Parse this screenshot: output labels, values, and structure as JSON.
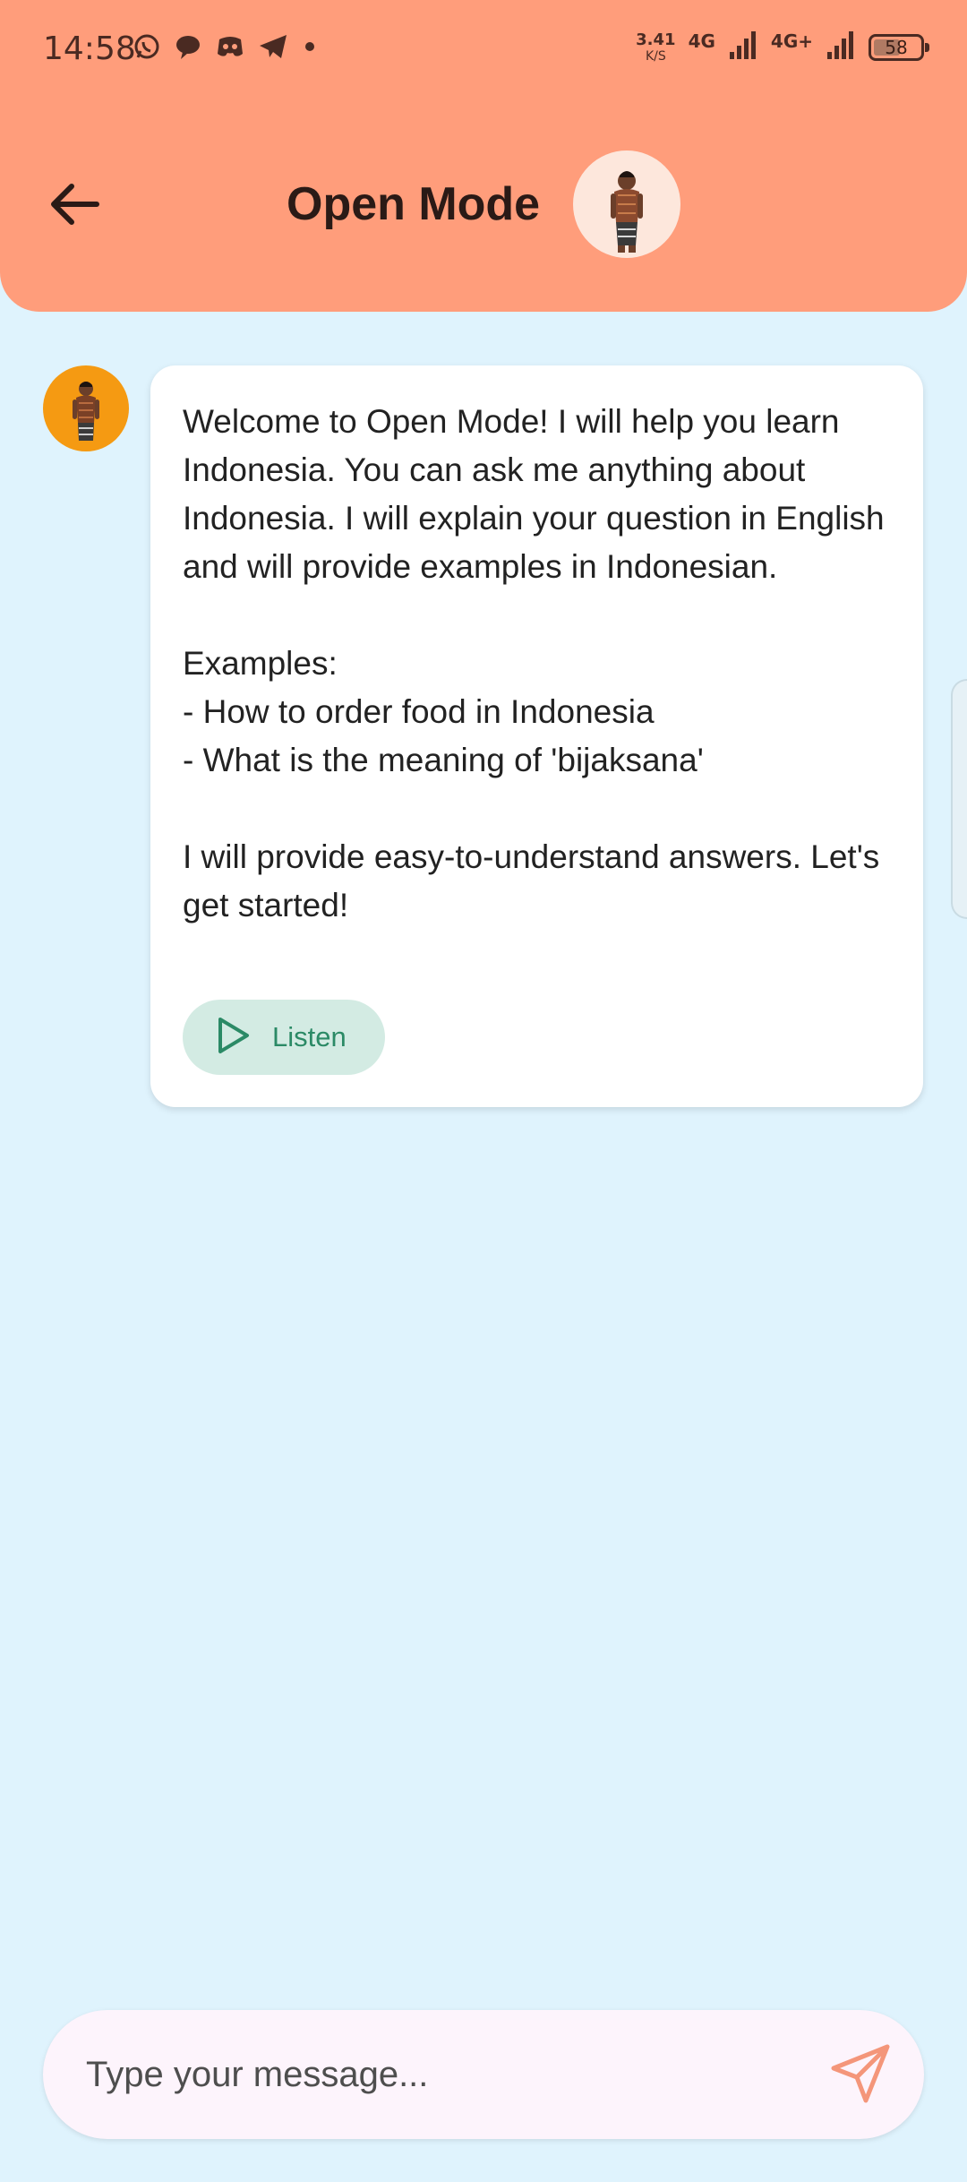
{
  "status_bar": {
    "time": "14:58",
    "notification_icons": [
      "whatsapp-icon",
      "chat-bubble-icon",
      "discord-icon",
      "telegram-icon",
      "dot-icon"
    ],
    "net_speed_value": "3.41",
    "net_speed_unit": "K/S",
    "network_1": "4G",
    "network_2": "4G+",
    "battery": "58",
    "battery_level_percent": 58
  },
  "header": {
    "title": "Open Mode",
    "back_icon": "arrow-left-icon",
    "background_color": "#ff9d7b"
  },
  "chat": {
    "messages": [
      {
        "sender": "bot",
        "text": "Welcome to Open Mode! I will help you learn Indonesia. You can ask me anything about Indonesia. I will explain your question in English and will provide examples in Indonesian.\n\nExamples:\n- How to order food in Indonesia\n- What is the meaning of 'bijaksana'\n\nI will provide easy-to-understand answers. Let's get started!",
        "listen_label": "Listen"
      }
    ]
  },
  "composer": {
    "placeholder": "Type your message...",
    "value": "",
    "send_icon": "send-icon",
    "accent_color": "#f4967a"
  },
  "colors": {
    "background": "#dff3fd",
    "listen_button": "#d3ebe3",
    "listen_text": "#2b8a66"
  }
}
